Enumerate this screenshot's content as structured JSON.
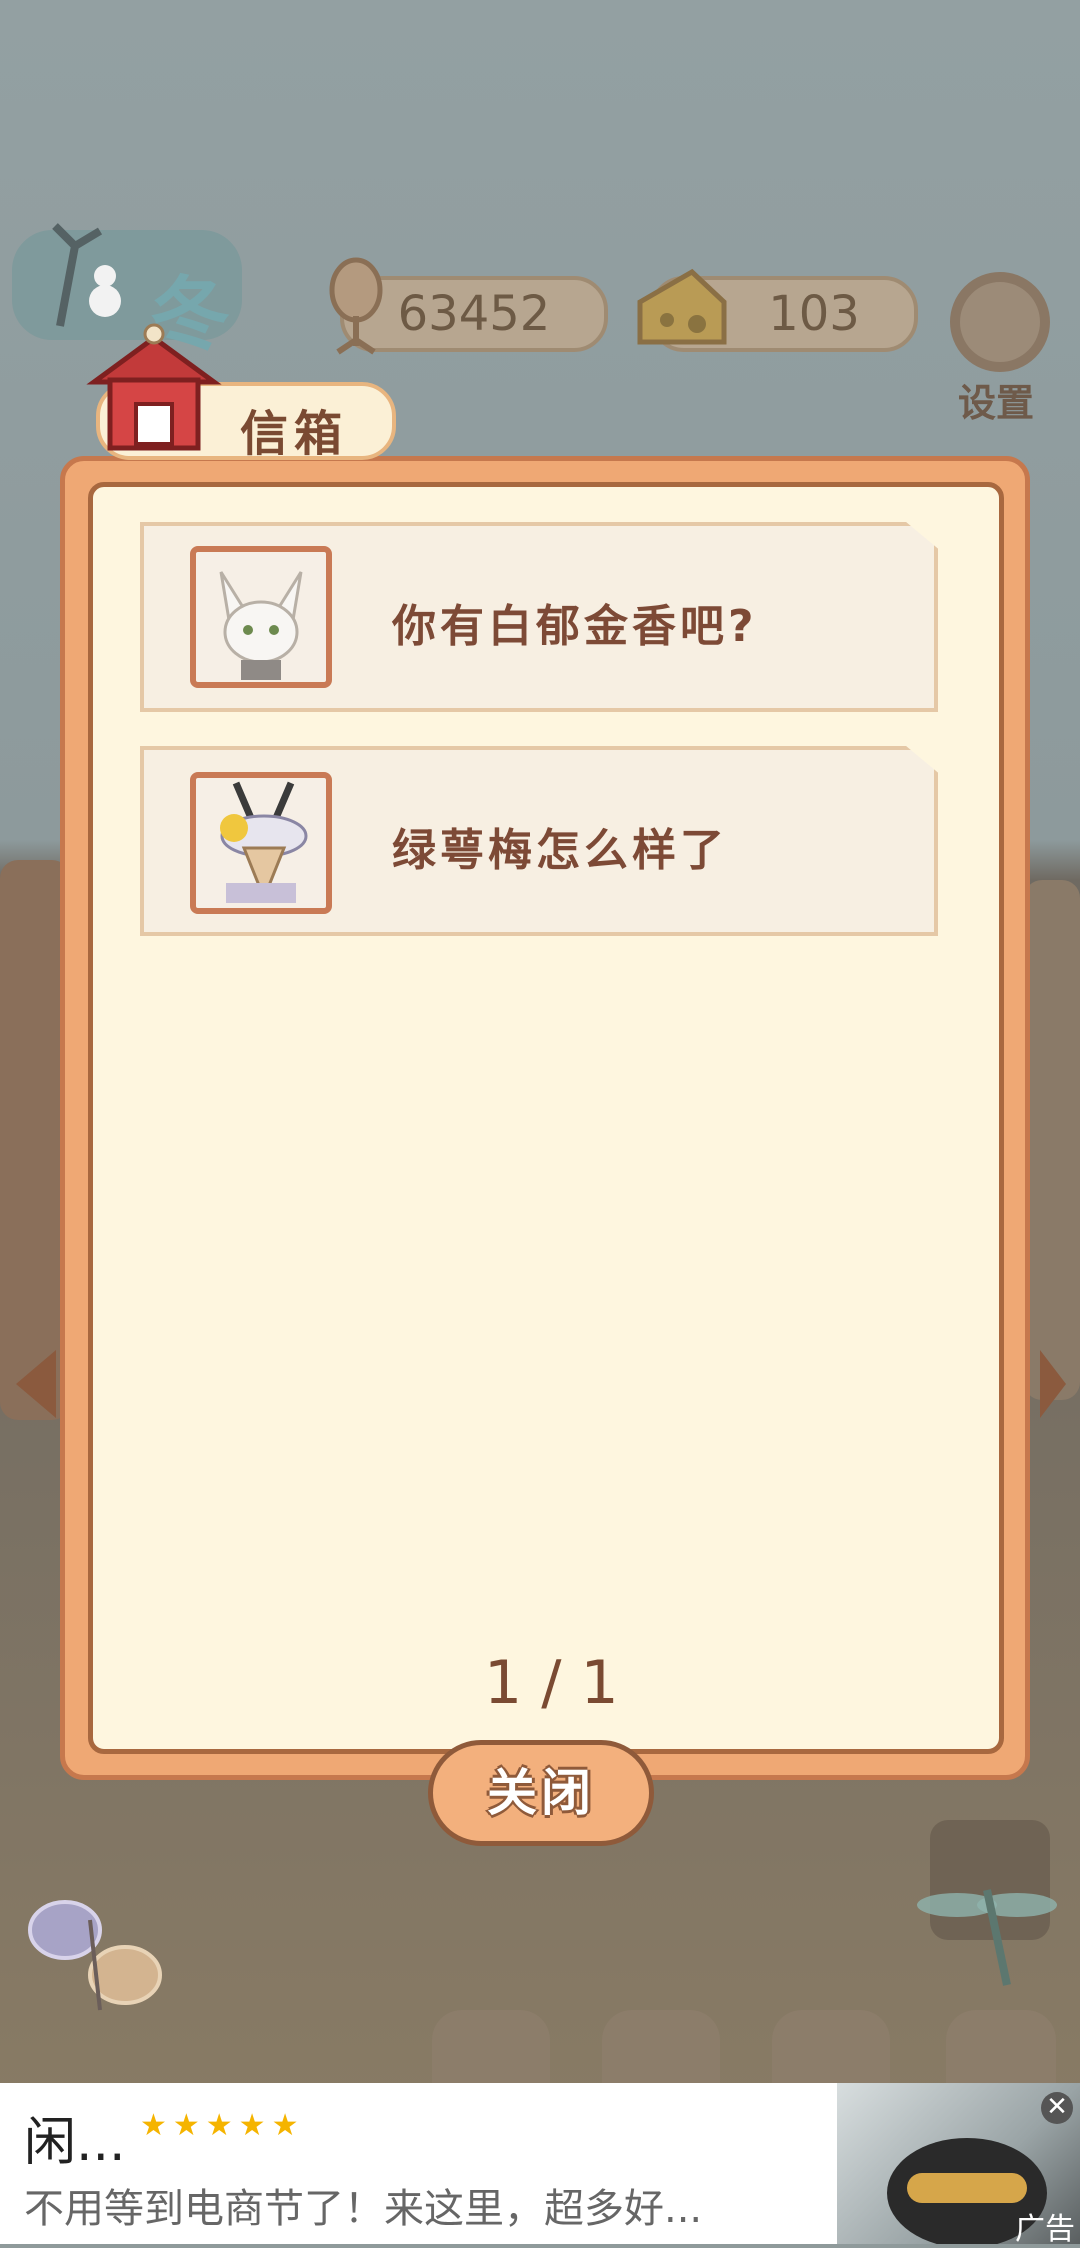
{
  "hud": {
    "season": "冬",
    "fish_count": "63452",
    "cheese_count": "103",
    "settings_label": "设置"
  },
  "mailbox": {
    "title": "信箱",
    "letters": [
      {
        "text": "你有白郁金香吧?",
        "avatar": "fox-avatar-icon"
      },
      {
        "text": "绿萼梅怎么样了",
        "avatar": "goat-avatar-icon"
      }
    ],
    "page_indicator": "1 / 1",
    "close_label": "关闭"
  },
  "ad": {
    "title": "闲...",
    "stars": "★★★★★",
    "body": "不用等到电商节了！来这里，超多好...",
    "close_symbol": "✕",
    "label": "广告"
  },
  "colors": {
    "dialog_frame": "#efa874",
    "dialog_paper": "#fef6df",
    "text_brown": "#7d4a36"
  }
}
